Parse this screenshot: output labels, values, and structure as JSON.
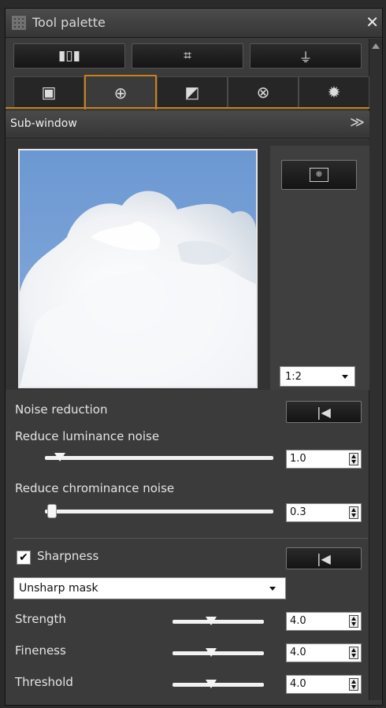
{
  "window": {
    "title": "Tool palette",
    "close_glyph": "✕"
  },
  "tool_buttons": [
    {
      "icon": "straighten-tool-icon",
      "glyph": "▮▯▮"
    },
    {
      "icon": "crop-tool-icon",
      "glyph": "⌗"
    },
    {
      "icon": "stamp-tool-icon",
      "glyph": "⏚"
    }
  ],
  "tabs": [
    {
      "icon": "basic-image-adjustment-icon",
      "glyph": "▣",
      "active": false
    },
    {
      "icon": "detail-zoom-icon",
      "glyph": "⊕",
      "active": true
    },
    {
      "icon": "tone-curve-icon",
      "glyph": "◩",
      "active": false
    },
    {
      "icon": "color-adjustment-icon",
      "glyph": "⊗",
      "active": false
    },
    {
      "icon": "settings-icon",
      "glyph": "✹",
      "active": false
    }
  ],
  "sub_window": {
    "label": "Sub-window",
    "collapse_glyph": "≫",
    "fit_glyph": "⊕",
    "zoom": "1:2"
  },
  "noise_reduction": {
    "label": "Noise reduction",
    "reset_glyph": "|◀",
    "luminance": {
      "label": "Reduce luminance noise",
      "value": "1.0"
    },
    "chrominance": {
      "label": "Reduce chrominance noise",
      "value": "0.3"
    }
  },
  "sharpness": {
    "label": "Sharpness",
    "checked_glyph": "✔",
    "checked": true,
    "reset_glyph": "|◀",
    "method": "Unsharp mask",
    "strength": {
      "label": "Strength",
      "value": "4.0"
    },
    "fineness": {
      "label": "Fineness",
      "value": "4.0"
    },
    "threshold": {
      "label": "Threshold",
      "value": "4.0"
    }
  }
}
